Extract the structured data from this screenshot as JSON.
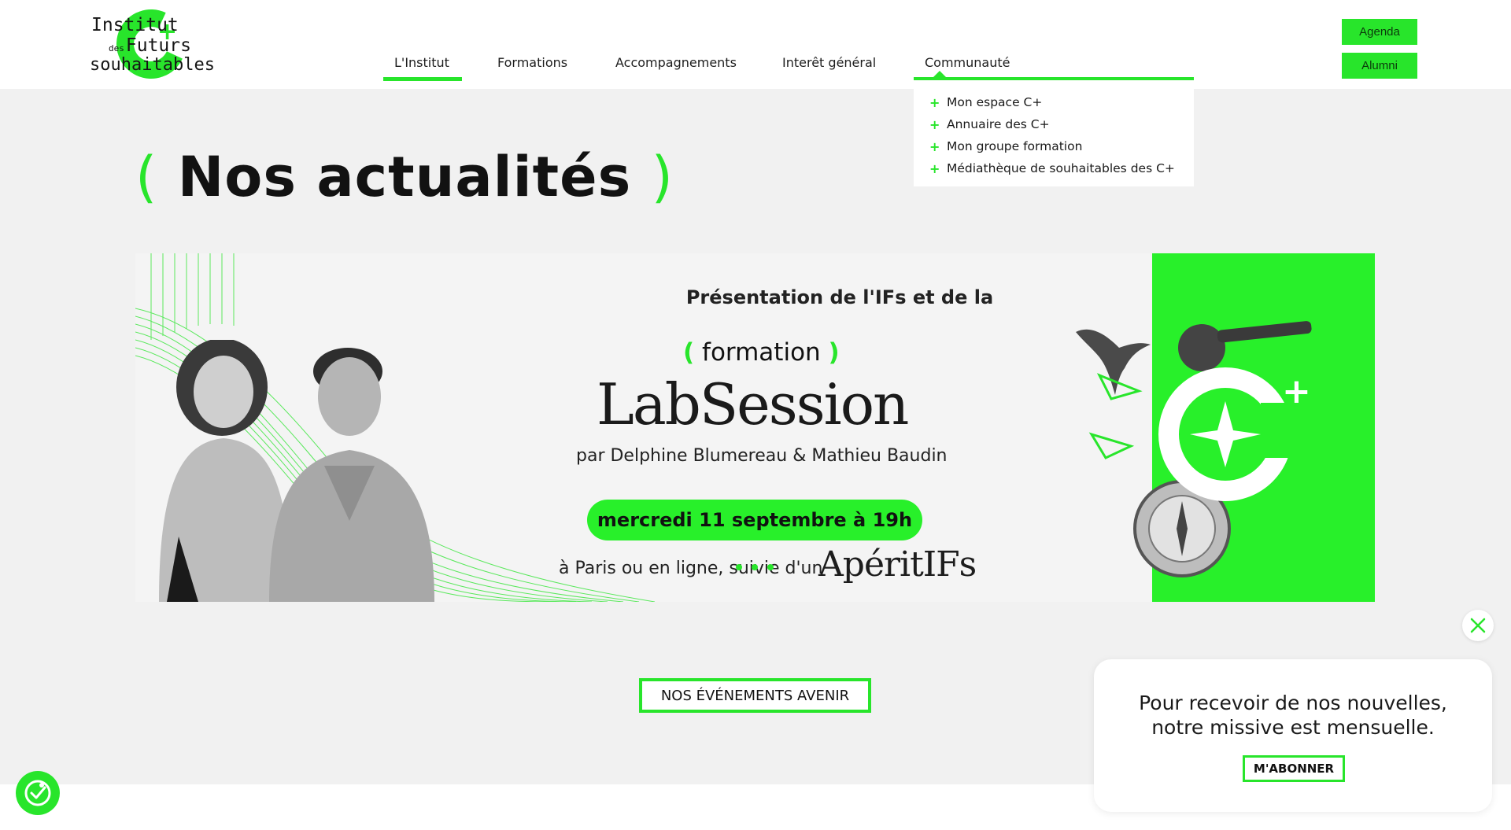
{
  "logo": {
    "line1": "Institut",
    "line2_small": "des",
    "line2": "Futurs",
    "line3": "souhaitables",
    "plus": "+"
  },
  "nav": {
    "items": [
      {
        "label": "L'Institut",
        "active": true
      },
      {
        "label": "Formations"
      },
      {
        "label": "Accompagnements"
      },
      {
        "label": "Interêt général"
      },
      {
        "label": "Communauté",
        "open": true
      }
    ]
  },
  "dropdown": {
    "bullet": "+",
    "items": [
      {
        "label": "Mon espace C+"
      },
      {
        "label": "Annuaire des C+"
      },
      {
        "label": "Mon groupe formation"
      },
      {
        "label": "Médiathèque de souhaitables des C+"
      }
    ]
  },
  "header_buttons": {
    "agenda": "Agenda",
    "alumni": "Alumni"
  },
  "page": {
    "title": "Nos actualités",
    "paren_open": "(",
    "paren_close": ")"
  },
  "banner": {
    "presentation": "Présentation de l'IFs et de la",
    "formation_open": "(",
    "formation": "formation",
    "formation_close": ")",
    "labsession": "LabSession",
    "authors": "par Delphine Blumereau & Mathieu Baudin",
    "date": "mercredi 11 septembre à 19h",
    "location": "à Paris ou en ligne, suivie d'un",
    "aperitifs": "ApéritIFs",
    "carousel_dots": 3
  },
  "events_button": "NOS ÉVÉNEMENTS AVENIR",
  "newsletter": {
    "line1": "Pour recevoir de nos nouvelles,",
    "line2": "notre missive est mensuelle.",
    "subscribe": "M'ABONNER"
  },
  "colors": {
    "brand_green": "#28e52b",
    "banner_green": "#28f02a",
    "text": "#111111",
    "bg": "#f1f1f1"
  },
  "icons": [
    "close-icon",
    "accessibility-icon",
    "plus-icon",
    "logo-c-icon"
  ]
}
